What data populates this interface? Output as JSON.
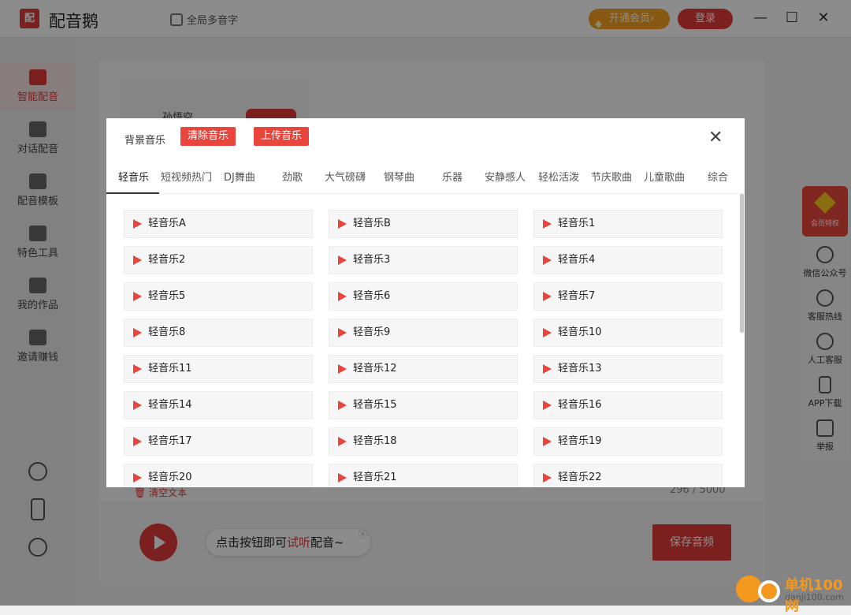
{
  "window": {
    "app_name": "配音鹅",
    "logo_glyph": "配",
    "poly_label": "全局多音字",
    "vip_label": "开通会员",
    "login_label": "登录"
  },
  "sidebar": {
    "items": [
      {
        "label": "智能配音",
        "active": true
      },
      {
        "label": "对话配音"
      },
      {
        "label": "配音模板"
      },
      {
        "label": "特色工具"
      },
      {
        "label": "我的作品"
      },
      {
        "label": "邀请赚钱"
      }
    ]
  },
  "editor": {
    "voice_name": "孙悟空",
    "clear_text": "清空文本",
    "counter": "296 / 5000",
    "hint_prefix": "点击按钮即可",
    "hint_highlight": "试听",
    "hint_suffix": "配音~",
    "save_label": "保存音频"
  },
  "right_panel": {
    "special_label": "会员特权",
    "items": [
      "微信公众号",
      "客服热线",
      "人工客服",
      "APP下载",
      "举报"
    ]
  },
  "dialog": {
    "title": "背景音乐",
    "clear_music": "清除音乐",
    "upload_music": "上传音乐",
    "tabs": [
      "轻音乐",
      "短视频热门",
      "DJ舞曲",
      "劲歌",
      "大气磅礴",
      "钢琴曲",
      "乐器",
      "安静感人",
      "轻松活泼",
      "节庆歌曲",
      "儿童歌曲",
      "综合"
    ],
    "tracks": [
      "轻音乐A",
      "轻音乐B",
      "轻音乐1",
      "轻音乐2",
      "轻音乐3",
      "轻音乐4",
      "轻音乐5",
      "轻音乐6",
      "轻音乐7",
      "轻音乐8",
      "轻音乐9",
      "轻音乐10",
      "轻音乐11",
      "轻音乐12",
      "轻音乐13",
      "轻音乐14",
      "轻音乐15",
      "轻音乐16",
      "轻音乐17",
      "轻音乐18",
      "轻音乐19",
      "轻音乐20",
      "轻音乐21",
      "轻音乐22"
    ]
  },
  "watermark": {
    "brand": "单机100网",
    "domain": "danji100.com"
  },
  "colors": {
    "accent": "#e23a3a",
    "vip": "#f4a11f"
  }
}
